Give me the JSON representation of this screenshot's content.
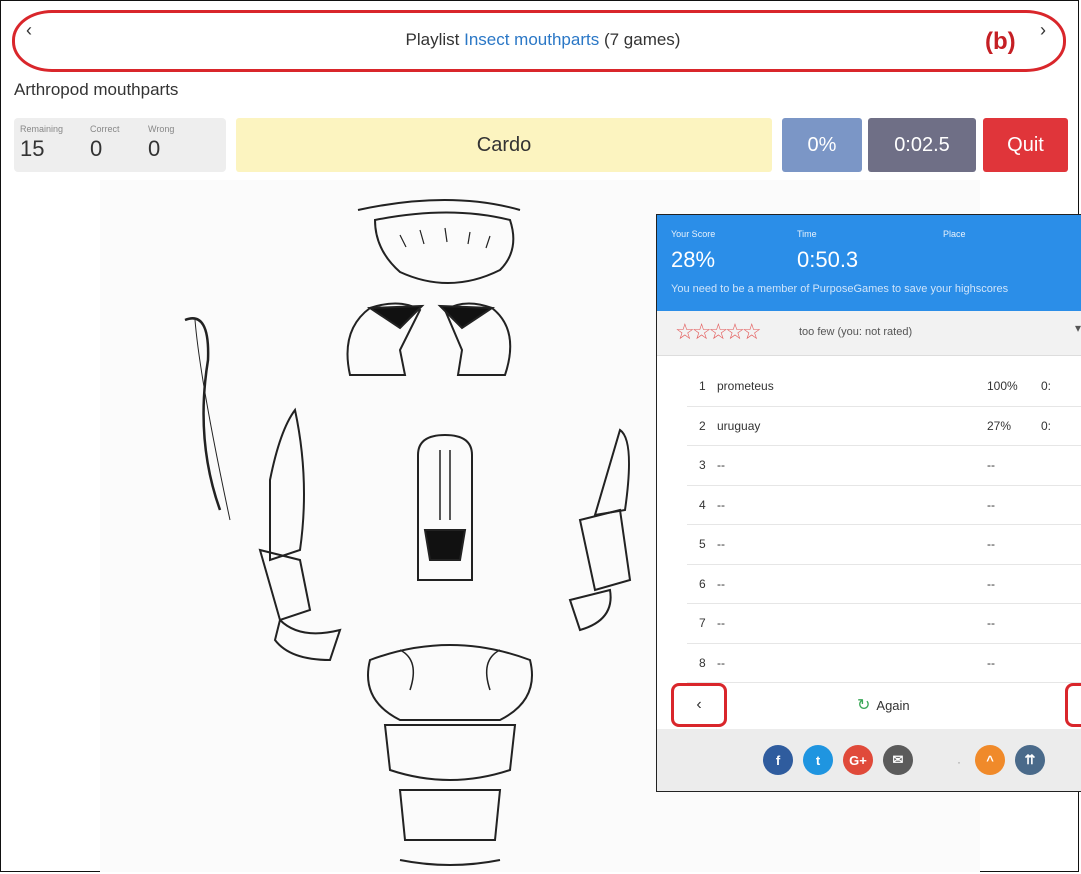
{
  "playlist": {
    "prefix": "Playlist ",
    "link": "Insect mouthparts",
    "suffix": " (7 games)",
    "prev": "‹",
    "next": "›",
    "marker": "(b)"
  },
  "game": {
    "title": "Arthropod mouthparts"
  },
  "stats": {
    "remaining_label": "Remaining",
    "remaining": "15",
    "correct_label": "Correct",
    "correct": "0",
    "wrong_label": "Wrong",
    "wrong": "0"
  },
  "prompt": "Cardo",
  "percent": "0%",
  "timer": "0:02.5",
  "quit": "Quit",
  "results": {
    "score_label": "Your Score",
    "score": "28%",
    "time_label": "Time",
    "time": "0:50.3",
    "place_label": "Place",
    "note": "You need to be a member of PurposeGames to save your highscores",
    "stars": "☆☆☆☆☆",
    "rating_text": "too few (you: not rated)",
    "rating_caret": "▾",
    "rows": [
      {
        "rank": "1",
        "name": "prometeus",
        "score": "100%",
        "time": "0:"
      },
      {
        "rank": "2",
        "name": "uruguay",
        "score": "27%",
        "time": "0:"
      },
      {
        "rank": "3",
        "name": "--",
        "score": "--",
        "time": ""
      },
      {
        "rank": "4",
        "name": "--",
        "score": "--",
        "time": ""
      },
      {
        "rank": "5",
        "name": "--",
        "score": "--",
        "time": ""
      },
      {
        "rank": "6",
        "name": "--",
        "score": "--",
        "time": ""
      },
      {
        "rank": "7",
        "name": "--",
        "score": "--",
        "time": ""
      },
      {
        "rank": "8",
        "name": "--",
        "score": "--",
        "time": ""
      }
    ],
    "back": "‹",
    "again": "Again",
    "again_icon": "↻",
    "share": [
      {
        "icon": "facebook-icon",
        "glyph": "f",
        "color": "#2f5c9e"
      },
      {
        "icon": "twitter-icon",
        "glyph": "t",
        "color": "#1f95e0"
      },
      {
        "icon": "google-plus-icon",
        "glyph": "G+",
        "color": "#e04a3a"
      },
      {
        "icon": "email-icon",
        "glyph": "✉",
        "color": "#5b5b5b"
      },
      {
        "icon": "scroll-up-icon",
        "glyph": "^",
        "color": "#f08a2a"
      },
      {
        "icon": "scroll-top-icon",
        "glyph": "⇈",
        "color": "#4a6a8a"
      }
    ],
    "separator": "·"
  }
}
